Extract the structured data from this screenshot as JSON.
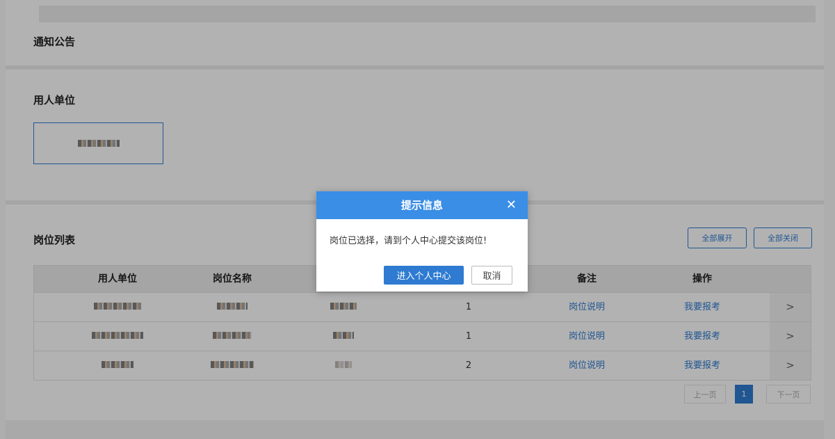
{
  "sections": {
    "notice_title": "通知公告",
    "units_title": "用人单位",
    "positions_title": "岗位列表"
  },
  "buttons": {
    "expand_all": "全部展开",
    "collapse_all": "全部关闭"
  },
  "table": {
    "headers": [
      "用人单位",
      "岗位名称",
      "备注",
      "操作"
    ],
    "rows": [
      {
        "count": "1",
        "note_link": "岗位说明",
        "action_link": "我要报考",
        "expand": ">"
      },
      {
        "count": "1",
        "note_link": "岗位说明",
        "action_link": "我要报考",
        "expand": ">"
      },
      {
        "count": "2",
        "note_link": "岗位说明",
        "action_link": "我要报考",
        "expand": ">"
      }
    ]
  },
  "pager": {
    "prev": "上一页",
    "current": "1",
    "next": "下一页"
  },
  "dialog": {
    "title": "提示信息",
    "close_icon": "close-icon",
    "message": "岗位已选择，请到个人中心提交该岗位!",
    "confirm": "进入个人中心",
    "cancel": "取消"
  },
  "colors": {
    "accent": "#2e7bd1",
    "dialog_header": "#3a8ee6"
  }
}
